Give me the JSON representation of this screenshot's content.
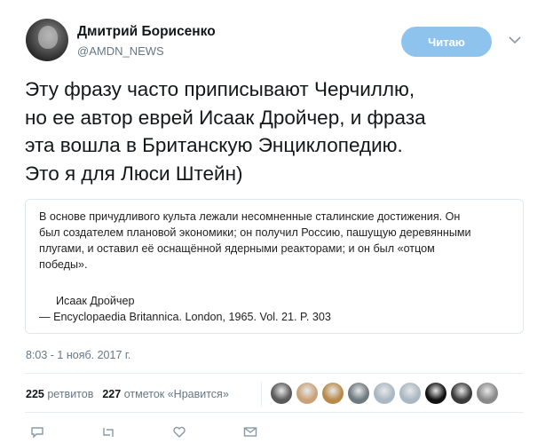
{
  "author": {
    "name": "Дмитрий Борисенко",
    "handle": "@AMDN_NEWS",
    "avatar_icon": "user-photo"
  },
  "follow_button": {
    "label": "Читаю",
    "color": "#8ec3ee"
  },
  "menu_icon": "chevron-down-icon",
  "tweet": {
    "lines": [
      "Эту фразу часто приписывают Черчиллю,",
      "но ее автор еврей Исаак Дройчер, и фраза",
      "эта вошла в Британскую Энциклопедию.",
      "Это я для Люси Штейн)"
    ]
  },
  "quote_image": {
    "lines": [
      "В основе причудливого культа лежали несомненные сталинские достижения. Он",
      "был создателем плановой экономики; он получил Россию, пашущую деревянными",
      "плугами, и оставил её оснащённой ядерными реакторами; и он был «отцом",
      "победы»."
    ],
    "author": "Исаак Дройчер",
    "source": "— Encyclopaedia Britannica. London, 1965. Vol. 21. P. 303"
  },
  "timestamp": "8:03 - 1 нояб. 2017 г.",
  "stats": {
    "retweets_count": "225",
    "retweets_label": "ретвитов",
    "likes_count": "227",
    "likes_label": "отметок «Нравится»"
  },
  "likers": [
    {
      "name": "liker-avatar-1",
      "color": "#5a5a5a"
    },
    {
      "name": "liker-avatar-2",
      "color": "#c9a27a"
    },
    {
      "name": "liker-avatar-3",
      "color": "#b88a4a"
    },
    {
      "name": "liker-avatar-4",
      "color": "#6e7a80"
    },
    {
      "name": "liker-avatar-5",
      "color": "#aab8c2"
    },
    {
      "name": "liker-avatar-6",
      "color": "#aab8c2"
    },
    {
      "name": "liker-avatar-7",
      "color": "#111111"
    },
    {
      "name": "liker-avatar-8",
      "color": "#3a3a3a"
    },
    {
      "name": "liker-avatar-9",
      "color": "#8a8a8a"
    }
  ],
  "actions": [
    "reply-icon",
    "retweet-icon",
    "like-icon",
    "message-icon"
  ]
}
